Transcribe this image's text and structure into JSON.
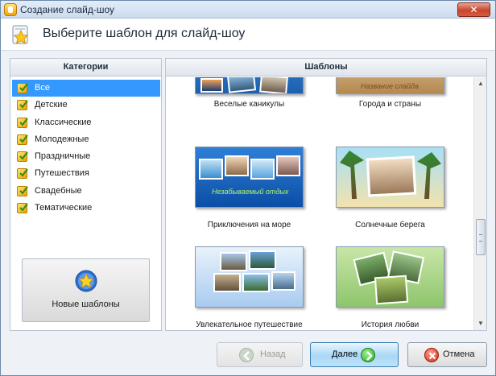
{
  "window": {
    "title": "Создание слайд-шоу"
  },
  "header": {
    "title": "Выберите шаблон для слайд-шоу"
  },
  "categories": {
    "heading": "Категории",
    "items": [
      {
        "label": "Все",
        "selected": true
      },
      {
        "label": "Детские",
        "selected": false
      },
      {
        "label": "Классические",
        "selected": false
      },
      {
        "label": "Молодежные",
        "selected": false
      },
      {
        "label": "Праздничные",
        "selected": false
      },
      {
        "label": "Путешествия",
        "selected": false
      },
      {
        "label": "Свадебные",
        "selected": false
      },
      {
        "label": "Тематические",
        "selected": false
      }
    ],
    "new_templates_label": "Новые шаблоны"
  },
  "templates": {
    "heading": "Шаблоны",
    "items": [
      {
        "name": "Веселые каникулы",
        "caption": ""
      },
      {
        "name": "Города и страны",
        "caption": "Название слайда"
      },
      {
        "name": "Приключения на море",
        "caption": "Незабываемый отдых"
      },
      {
        "name": "Солнечные берега",
        "caption": ""
      },
      {
        "name": "Увлекательное путешествие",
        "caption": ""
      },
      {
        "name": "История любви",
        "caption": ""
      }
    ]
  },
  "buttons": {
    "back": "Назад",
    "next": "Далее",
    "cancel": "Отмена"
  },
  "colors": {
    "selection": "#3399ff",
    "next_button": "#a8d7f5",
    "close_button": "#c6462d"
  }
}
